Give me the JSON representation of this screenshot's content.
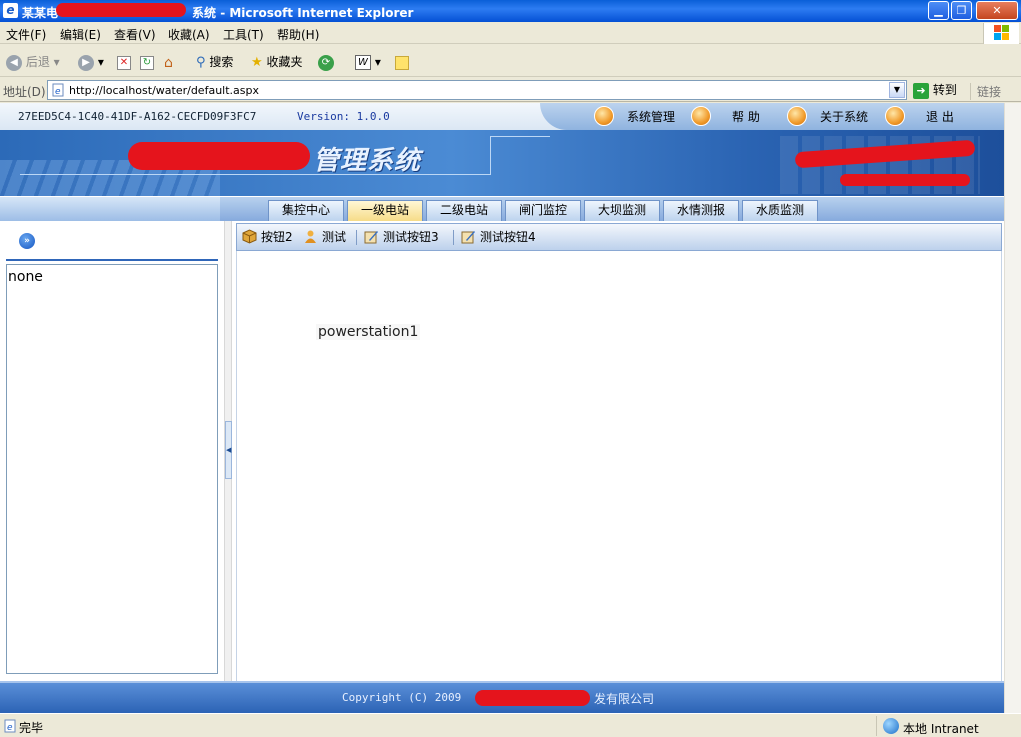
{
  "window": {
    "title_prefix": "某某电",
    "title_suffix": "Microsoft Internet Explorer",
    "title_mid": "系统 - "
  },
  "menu": [
    "文件(F)",
    "编辑(E)",
    "查看(V)",
    "收藏(A)",
    "工具(T)",
    "帮助(H)"
  ],
  "toolbar": {
    "back_label": "后退",
    "search_label": "搜索",
    "favorites_label": "收藏夹"
  },
  "address": {
    "label": "地址(D)",
    "url": "http://localhost/water/default.aspx",
    "go_label": "转到",
    "links_label": "链接"
  },
  "header": {
    "guid": "27EED5C4-1C40-41DF-A162-CECFD09F3FC7",
    "version": "Version: 1.0.0",
    "nav": [
      "系统管理",
      "帮 助",
      "关于系统",
      "退 出"
    ],
    "banner_title": "管理系统"
  },
  "tabs": [
    "集控中心",
    "一级电站",
    "二级电站",
    "闸门监控",
    "大坝监测",
    "水情测报",
    "水质监测"
  ],
  "active_tab": 1,
  "left": {
    "tree_text": "none"
  },
  "main": {
    "buttons": [
      "按钮2",
      "测试",
      "测试按钮3",
      "测试按钮4"
    ],
    "content_label": "powerstation1"
  },
  "footer": {
    "copyright": "Copyright (C) 2009",
    "company_suffix": "发有限公司"
  },
  "status": {
    "text": "完毕",
    "zone": "本地 Intranet"
  },
  "colors": {
    "banner_blue": "#2c6ab8",
    "tab_active": "#f6dc88",
    "redaction": "#e5141c"
  }
}
